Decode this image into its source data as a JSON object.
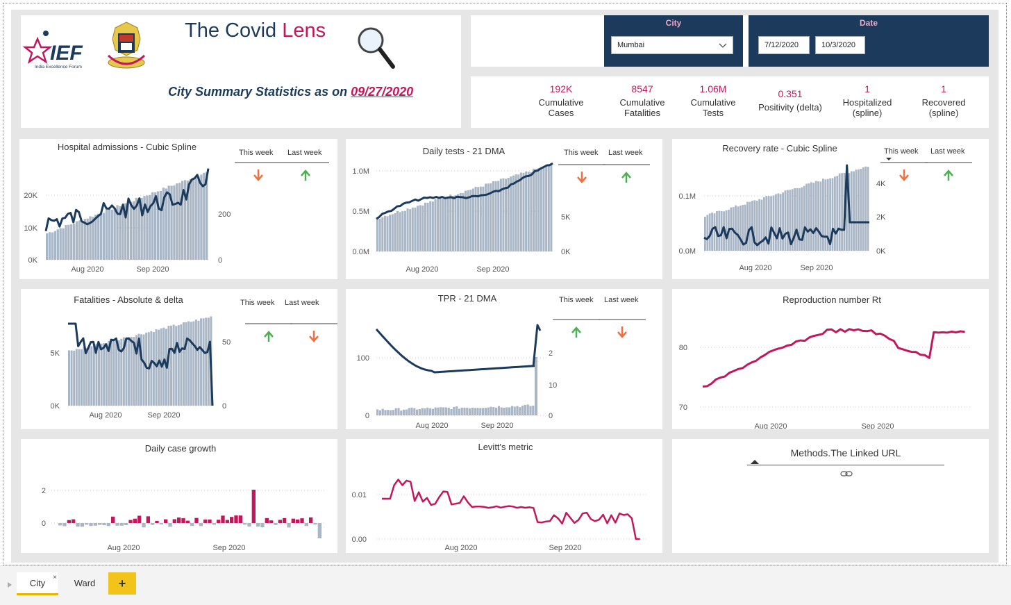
{
  "header": {
    "org_abbr": "IEF",
    "org_name": "India Excellence Forum",
    "title_part1": "The Covid ",
    "title_part2": "Lens",
    "summary_label": "City Summary Statistics as on ",
    "summary_date": "09/27/2020"
  },
  "filters": {
    "city_label": "City",
    "city_value": "Mumbai",
    "date_label": "Date",
    "date_start": "7/12/2020",
    "date_end": "10/3/2020"
  },
  "kpis": [
    {
      "value": "192K",
      "label1": "Cumulative",
      "label2": "Cases"
    },
    {
      "value": "8547",
      "label1": "Cumulative",
      "label2": "Fatalities"
    },
    {
      "value": "1.06M",
      "label1": "Cumulative",
      "label2": "Tests"
    },
    {
      "value": "0.351",
      "label1": "Positivity (delta)",
      "label2": ""
    },
    {
      "value": "1",
      "label1": "Hospitalized",
      "label2": "(spline)"
    },
    {
      "value": "1",
      "label1": "Recovered",
      "label2": "(spline)"
    }
  ],
  "week_labels": {
    "this_week": "This week",
    "last_week": "Last week"
  },
  "colors": {
    "navy": "#1b3a5c",
    "magenta": "#c2185b",
    "bar_gray": "#a9b6c6",
    "down_red": "#f06e40",
    "up_green": "#4caf50"
  },
  "charts": {
    "hospital": {
      "title": "Hospital admissions - Cubic Spline",
      "y_left": [
        "20K",
        "10K",
        "0K"
      ],
      "y_right": [
        "200",
        "0"
      ],
      "x": [
        "Aug 2020",
        "Sep 2020"
      ]
    },
    "tests": {
      "title": "Daily tests - 21 DMA",
      "y_left": [
        "1.0M",
        "0.5M",
        "0.0M"
      ],
      "y_right": [
        "5K",
        "0K"
      ],
      "x": [
        "Aug 2020",
        "Sep 2020"
      ]
    },
    "recovery": {
      "title": "Recovery rate - Cubic Spline",
      "y_left": [
        "0.1M",
        "0.0M"
      ],
      "y_right": [
        "4K",
        "2K",
        "0K"
      ],
      "x": [
        "Aug 2020",
        "Sep 2020"
      ]
    },
    "fatalities": {
      "title": "Fatalities - Absolute & delta",
      "y_left": [
        "5K",
        "0K"
      ],
      "y_right": [
        "50",
        "0"
      ],
      "x": [
        "Aug 2020",
        "Sep 2020"
      ]
    },
    "tpr": {
      "title": "TPR - 21 DMA",
      "y_left": [
        "100",
        "0"
      ],
      "y_right": [
        "2",
        "10",
        "0"
      ],
      "x": [
        "Aug 2020",
        "Sep 2020"
      ]
    },
    "rt": {
      "title": "Reproduction number Rt",
      "y_left": [
        "80",
        "70"
      ],
      "x": [
        "Aug 2020",
        "Sep 2020"
      ]
    },
    "growth": {
      "title": "Daily case growth",
      "y_left": [
        "2",
        "0"
      ],
      "x": [
        "Aug 2020",
        "Sep 2020"
      ]
    },
    "levitt": {
      "title": "Levitt's metric",
      "y_left": [
        "0.01",
        "0.00"
      ],
      "x": [
        "Aug 2020",
        "Sep 2020"
      ]
    }
  },
  "methods": {
    "title": "Methods.The Linked URL"
  },
  "tabs": {
    "city": "City",
    "ward": "Ward",
    "add": "+"
  }
}
